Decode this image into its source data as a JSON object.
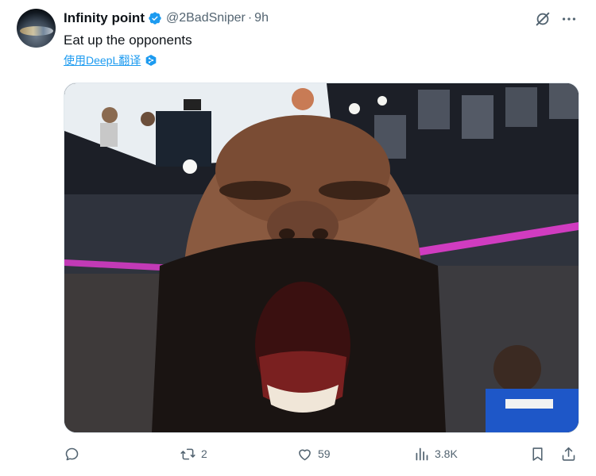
{
  "tweet": {
    "author_name": "Infinity point",
    "handle": "@2BadSniper",
    "separator": "·",
    "time": "9h",
    "text": "Eat up the opponents",
    "translate_link": "使用DeepL翻译"
  },
  "actions": {
    "replies": "",
    "retweets": "2",
    "likes": "59",
    "views": "3.8K"
  },
  "colors": {
    "verified": "#1d9bf0",
    "link": "#1d9bf0",
    "muted": "#536471",
    "text": "#0f1419"
  },
  "icons": [
    "grok-icon",
    "more-icon",
    "deepl-icon",
    "reply-icon",
    "retweet-icon",
    "like-icon",
    "views-icon",
    "bookmark-icon",
    "share-icon",
    "verified-badge-icon"
  ]
}
